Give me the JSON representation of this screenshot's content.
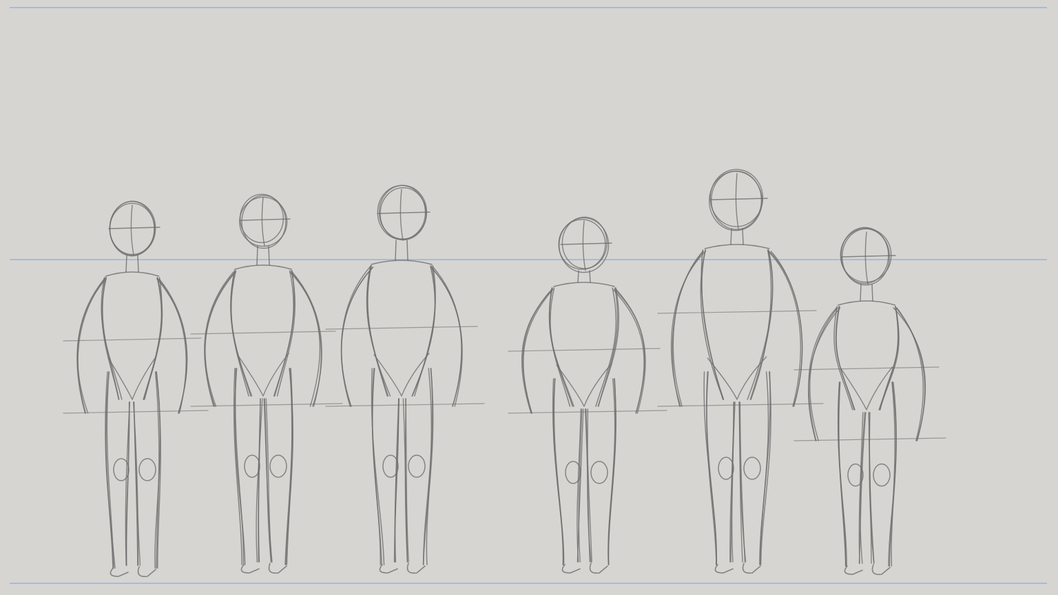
{
  "canvas": {
    "background_color": "#d6d5d1",
    "guide_line_color": "#8fb3e6",
    "sketch_stroke_color": "#6e6e6e"
  },
  "guides": [
    {
      "name": "top-guide-line"
    },
    {
      "name": "shoulder-guide-line"
    },
    {
      "name": "ground-guide-line"
    }
  ],
  "figures": [
    {
      "name": "figure-1"
    },
    {
      "name": "figure-2"
    },
    {
      "name": "figure-3"
    },
    {
      "name": "figure-4"
    },
    {
      "name": "figure-5"
    },
    {
      "name": "figure-6"
    }
  ]
}
